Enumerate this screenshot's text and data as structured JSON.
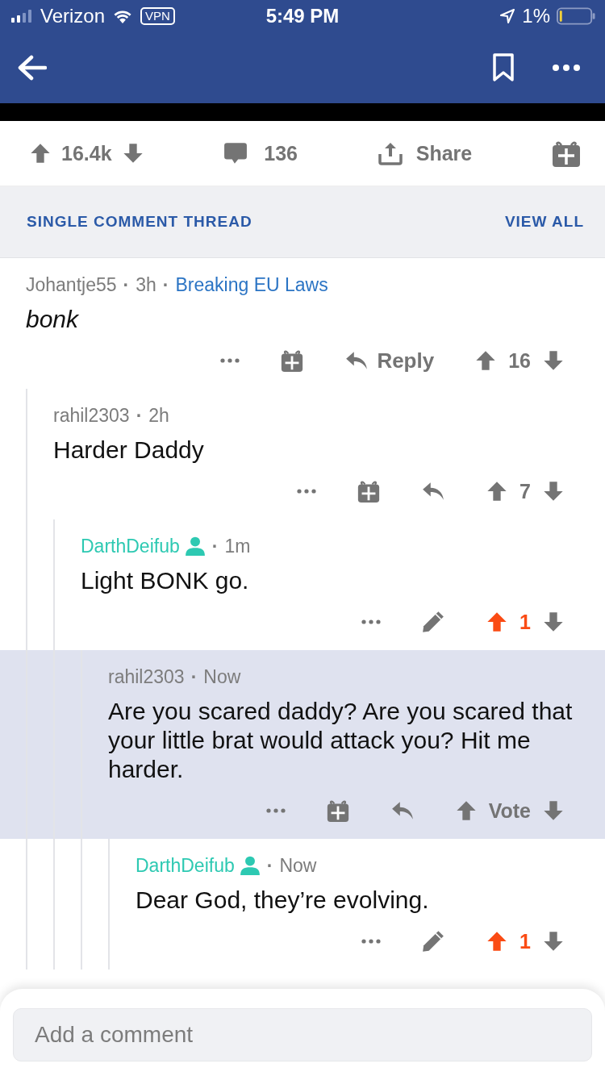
{
  "status_bar": {
    "carrier": "Verizon",
    "vpn": "VPN",
    "time": "5:49 PM",
    "battery": "1%"
  },
  "post_actions": {
    "score": "16.4k",
    "comments": "136",
    "share": "Share"
  },
  "thread_header": {
    "title": "SINGLE COMMENT THREAD",
    "view_all": "VIEW ALL"
  },
  "comments": [
    {
      "author": "Johantje55",
      "submitter": false,
      "time_dot": "·",
      "time": "3h",
      "flair_dot": "·",
      "flair": "Breaking EU Laws",
      "body": "bonk",
      "italic": true,
      "highlighted": false,
      "actions": [
        {
          "kind": "more"
        },
        {
          "kind": "gift"
        },
        {
          "kind": "reply",
          "label": "Reply"
        }
      ],
      "vote": {
        "score": "16",
        "upvoted": false
      },
      "children": [
        {
          "author": "rahil2303",
          "submitter": false,
          "time_dot": "·",
          "time": "2h",
          "body": "Harder Daddy",
          "italic": false,
          "highlighted": false,
          "actions": [
            {
              "kind": "more"
            },
            {
              "kind": "gift"
            },
            {
              "kind": "reply"
            }
          ],
          "vote": {
            "score": "7",
            "upvoted": false
          },
          "children": [
            {
              "author": "DarthDeifub",
              "submitter": true,
              "time_dot": "·",
              "time": "1m",
              "body": "Light BONK go.",
              "italic": false,
              "highlighted": false,
              "actions": [
                {
                  "kind": "more"
                },
                {
                  "kind": "edit"
                }
              ],
              "vote": {
                "score": "1",
                "upvoted": true
              },
              "children": [
                {
                  "author": "rahil2303",
                  "submitter": false,
                  "time_dot": "·",
                  "time": "Now",
                  "body": "Are you scared daddy? Are you scared that your little brat would attack you? Hit me harder.",
                  "italic": false,
                  "highlighted": true,
                  "actions": [
                    {
                      "kind": "more"
                    },
                    {
                      "kind": "gift"
                    },
                    {
                      "kind": "reply"
                    }
                  ],
                  "vote": {
                    "score": "Vote",
                    "upvoted": false
                  },
                  "children": [
                    {
                      "author": "DarthDeifub",
                      "submitter": true,
                      "time_dot": "·",
                      "time": "Now",
                      "body": "Dear God, they’re evolving.",
                      "italic": false,
                      "highlighted": false,
                      "actions": [
                        {
                          "kind": "more"
                        },
                        {
                          "kind": "edit"
                        }
                      ],
                      "vote": {
                        "score": "1",
                        "upvoted": true
                      }
                    }
                  ]
                }
              ]
            }
          ]
        }
      ]
    }
  ],
  "composer": {
    "placeholder": "Add a comment"
  }
}
